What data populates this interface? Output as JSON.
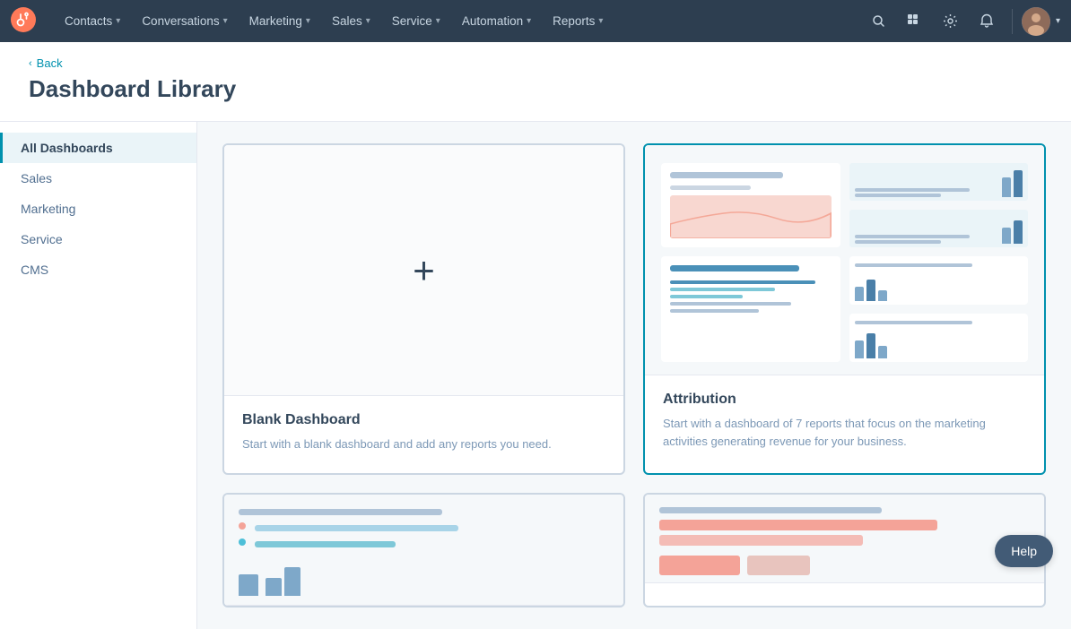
{
  "nav": {
    "logo_label": "HubSpot",
    "items": [
      {
        "label": "Contacts",
        "has_chevron": true
      },
      {
        "label": "Conversations",
        "has_chevron": true
      },
      {
        "label": "Marketing",
        "has_chevron": true
      },
      {
        "label": "Sales",
        "has_chevron": true
      },
      {
        "label": "Service",
        "has_chevron": true
      },
      {
        "label": "Automation",
        "has_chevron": true
      },
      {
        "label": "Reports",
        "has_chevron": true
      }
    ]
  },
  "header": {
    "back_label": "Back",
    "title": "Dashboard Library"
  },
  "sidebar": {
    "items": [
      {
        "label": "All Dashboards",
        "active": true
      },
      {
        "label": "Sales",
        "active": false
      },
      {
        "label": "Marketing",
        "active": false
      },
      {
        "label": "Service",
        "active": false
      },
      {
        "label": "CMS",
        "active": false
      }
    ]
  },
  "cards": [
    {
      "id": "blank",
      "title": "Blank Dashboard",
      "description": "Start with a blank dashboard and add any reports you need.",
      "type": "blank"
    },
    {
      "id": "attribution",
      "title": "Attribution",
      "description": "Start with a dashboard of 7 reports that focus on the marketing activities generating revenue for your business.",
      "type": "attribution",
      "selected": true
    },
    {
      "id": "card3",
      "title": "",
      "description": "",
      "type": "partial-left"
    },
    {
      "id": "card4",
      "title": "",
      "description": "",
      "type": "partial-right"
    }
  ],
  "help": {
    "label": "Help"
  }
}
